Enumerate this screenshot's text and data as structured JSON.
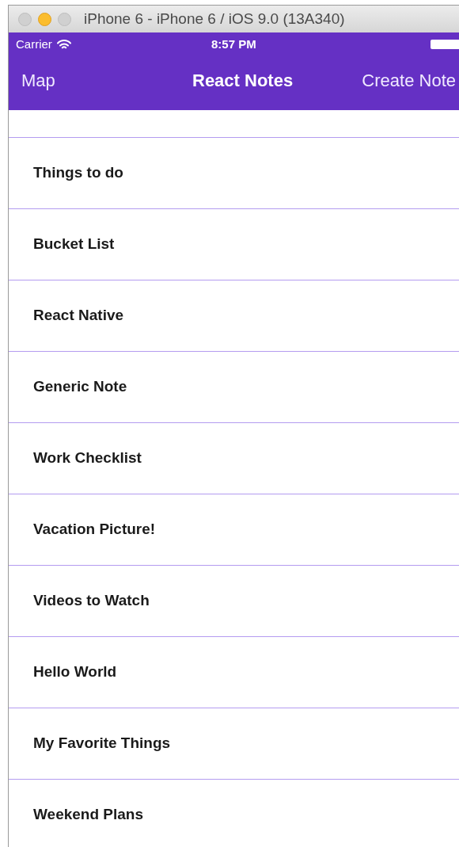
{
  "window": {
    "title": "iPhone 6 - iPhone 6 / iOS 9.0 (13A340)"
  },
  "status_bar": {
    "carrier": "Carrier",
    "time": "8:57 PM"
  },
  "nav_bar": {
    "left": "Map",
    "title": "React Notes",
    "right": "Create Note"
  },
  "notes": [
    {
      "title": "Things to do"
    },
    {
      "title": "Bucket List"
    },
    {
      "title": "React Native"
    },
    {
      "title": "Generic Note"
    },
    {
      "title": "Work Checklist"
    },
    {
      "title": "Vacation Picture!"
    },
    {
      "title": "Videos to Watch"
    },
    {
      "title": "Hello World"
    },
    {
      "title": "My Favorite Things"
    },
    {
      "title": "Weekend Plans"
    }
  ]
}
